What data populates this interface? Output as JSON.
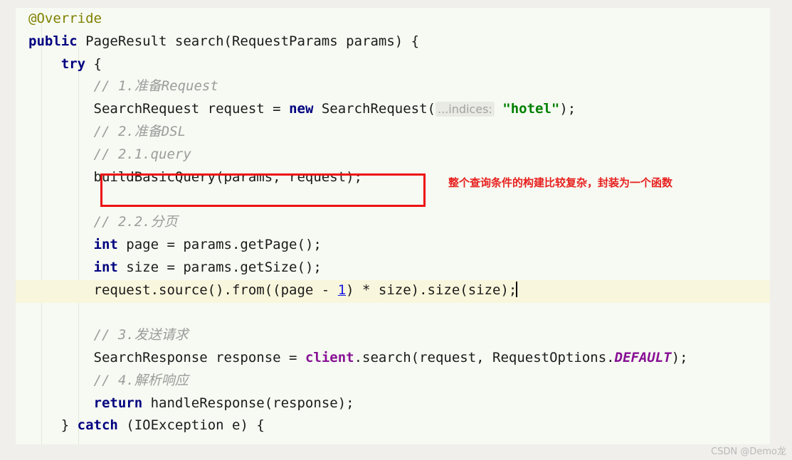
{
  "editor": {
    "language": "java",
    "background_color": "#f6faf2",
    "outside_color": "#f0efeb",
    "caret_line_color": "#f8f6dc",
    "font_size_px": 19,
    "line_height_px": 31.8,
    "caret_line_index": 12,
    "lines": [
      {
        "indent": 0,
        "tokens": [
          {
            "type": "anno",
            "text": "@Override"
          }
        ]
      },
      {
        "indent": 0,
        "tokens": [
          {
            "type": "kw",
            "text": "public"
          },
          {
            "type": "plain",
            "text": " PageResult search(RequestParams params) {"
          }
        ]
      },
      {
        "indent": 1,
        "tokens": [
          {
            "type": "kw",
            "text": "try"
          },
          {
            "type": "plain",
            "text": " {"
          }
        ]
      },
      {
        "indent": 2,
        "tokens": [
          {
            "type": "cmt",
            "text": "// 1.准备Request"
          }
        ]
      },
      {
        "indent": 2,
        "tokens": [
          {
            "type": "plain",
            "text": "SearchRequest request = "
          },
          {
            "type": "kw",
            "text": "new"
          },
          {
            "type": "plain",
            "text": " SearchRequest("
          },
          {
            "type": "hint",
            "text": "...indices:"
          },
          {
            "type": "plain",
            "text": " "
          },
          {
            "type": "str",
            "text": "\"hotel\""
          },
          {
            "type": "plain",
            "text": ");"
          }
        ]
      },
      {
        "indent": 2,
        "tokens": [
          {
            "type": "cmt",
            "text": "// 2.准备DSL"
          }
        ]
      },
      {
        "indent": 2,
        "tokens": [
          {
            "type": "cmt",
            "text": "// 2.1.query"
          }
        ]
      },
      {
        "indent": 2,
        "tokens": [
          {
            "type": "plain",
            "text": "buildBasicQuery(params, request);"
          }
        ]
      },
      {
        "indent": 0,
        "tokens": []
      },
      {
        "indent": 2,
        "tokens": [
          {
            "type": "cmt",
            "text": "// 2.2.分页"
          }
        ]
      },
      {
        "indent": 2,
        "tokens": [
          {
            "type": "kw",
            "text": "int"
          },
          {
            "type": "plain",
            "text": " page = params.getPage();"
          }
        ]
      },
      {
        "indent": 2,
        "tokens": [
          {
            "type": "kw",
            "text": "int"
          },
          {
            "type": "plain",
            "text": " size = params.getSize();"
          }
        ]
      },
      {
        "indent": 2,
        "tokens": [
          {
            "type": "plain",
            "text": "request.source().from((page - "
          },
          {
            "type": "num",
            "text": "1"
          },
          {
            "type": "plain",
            "text": ") * size).size(size);"
          },
          {
            "type": "caret",
            "text": ""
          }
        ]
      },
      {
        "indent": 0,
        "tokens": []
      },
      {
        "indent": 2,
        "tokens": [
          {
            "type": "cmt",
            "text": "// 3.发送请求"
          }
        ]
      },
      {
        "indent": 2,
        "tokens": [
          {
            "type": "plain",
            "text": "SearchResponse response = "
          },
          {
            "type": "field",
            "text": "client"
          },
          {
            "type": "plain",
            "text": ".search(request, RequestOptions."
          },
          {
            "type": "statfield",
            "text": "DEFAULT"
          },
          {
            "type": "plain",
            "text": ");"
          }
        ]
      },
      {
        "indent": 2,
        "tokens": [
          {
            "type": "cmt",
            "text": "// 4.解析响应"
          }
        ]
      },
      {
        "indent": 2,
        "tokens": [
          {
            "type": "kw",
            "text": "return"
          },
          {
            "type": "plain",
            "text": " handleResponse(response);"
          }
        ]
      },
      {
        "indent": 1,
        "tokens": [
          {
            "type": "plain",
            "text": "} "
          },
          {
            "type": "kw",
            "text": "catch"
          },
          {
            "type": "plain",
            "text": " (IOException e) {"
          }
        ]
      }
    ]
  },
  "annotations": {
    "red_box": {
      "target_text": "buildBasicQuery(params, request);",
      "color": "#ee1111"
    },
    "red_note": {
      "text": "整个查询条件的构建比较复杂，封装为一个函数",
      "color": "#e8201f"
    }
  },
  "watermark": {
    "text": "CSDN @Demo龙",
    "color": "#b9b9b9"
  },
  "token_colors": {
    "keyword": "#000080",
    "annotation": "#808000",
    "comment": "#9c9c9c",
    "string": "#008000",
    "number": "#1a1ae6",
    "field": "#871094",
    "static_field": "#871094",
    "plain": "#1a1a1a",
    "param_hint_bg": "#eaeae4",
    "param_hint_fg": "#a2a2a2"
  }
}
